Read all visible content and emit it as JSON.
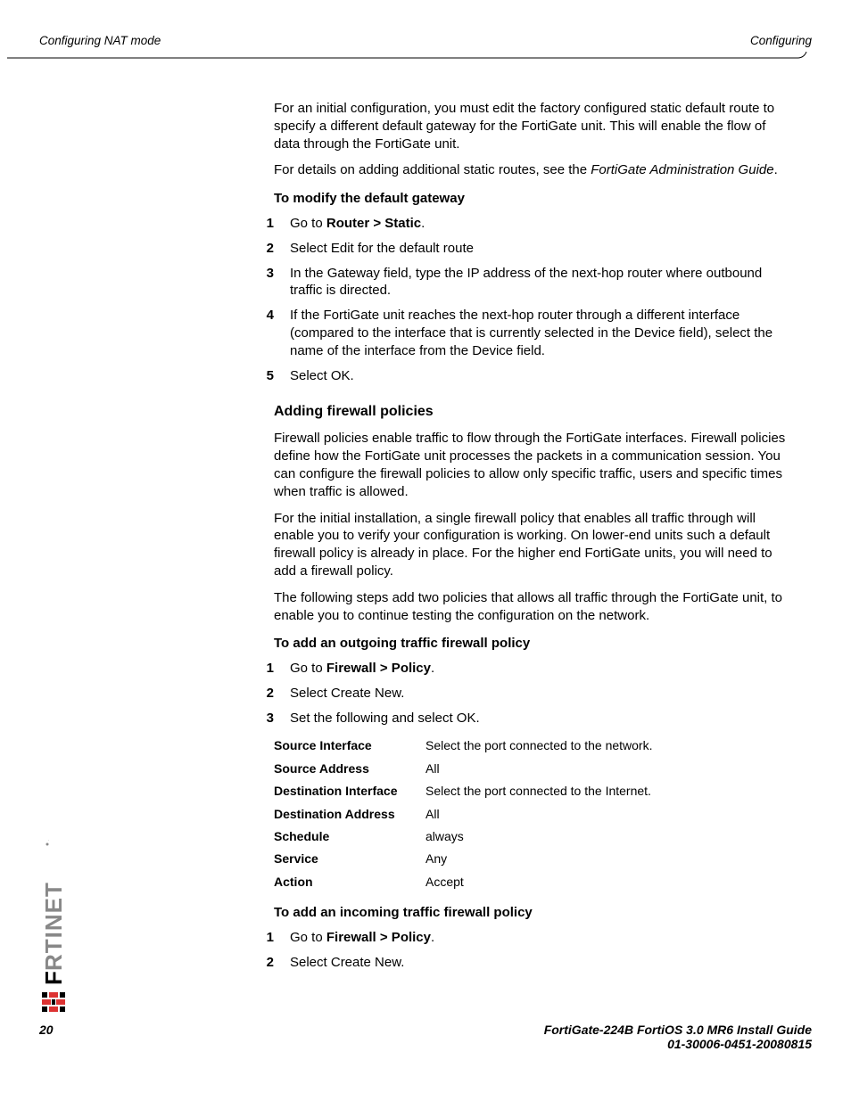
{
  "header": {
    "left": "Configuring NAT mode",
    "right": "Configuring"
  },
  "intro": {
    "p1": "For an initial configuration, you must edit the factory configured static default route to specify a different default gateway for the FortiGate unit. This will enable the flow of data through the FortiGate unit.",
    "p2_a": "For details on adding additional static routes, see the ",
    "p2_em": "FortiGate Administration Guide",
    "p2_b": "."
  },
  "modify_gw": {
    "heading": "To modify the default gateway",
    "steps": [
      {
        "n": "1",
        "pre": "Go to ",
        "bold": "Router > Static",
        "post": "."
      },
      {
        "n": "2",
        "text": "Select Edit for the default route"
      },
      {
        "n": "3",
        "text": "In the Gateway field, type the IP address of the next-hop router where outbound traffic is directed."
      },
      {
        "n": "4",
        "text": "If the FortiGate unit reaches the next-hop router through a different interface (compared to the interface that is currently selected in the Device field), select the name of the interface from the Device field."
      },
      {
        "n": "5",
        "text": "Select OK."
      }
    ]
  },
  "firewall": {
    "heading": "Adding firewall policies",
    "p1": "Firewall policies enable traffic to flow through the FortiGate interfaces. Firewall policies define how the FortiGate unit processes the packets in a communication session. You can configure the firewall policies to allow only specific traffic, users and specific times when traffic is allowed.",
    "p2": "For the initial installation, a single firewall policy that enables all traffic through will enable you to verify your configuration is working. On lower-end units such a default firewall policy is already in place. For the higher end FortiGate units, you will need to add a firewall policy.",
    "p3": "The following steps add two policies that allows all traffic through the FortiGate unit, to enable you to continue testing the configuration on the network."
  },
  "outgoing": {
    "heading": "To add an outgoing traffic firewall policy",
    "steps": [
      {
        "n": "1",
        "pre": "Go to ",
        "bold": "Firewall > Policy",
        "post": "."
      },
      {
        "n": "2",
        "text": "Select Create New."
      },
      {
        "n": "3",
        "text": "Set the following and select OK."
      }
    ],
    "settings": [
      {
        "k": "Source Interface",
        "v": "Select the port connected to the network."
      },
      {
        "k": "Source Address",
        "v": "All"
      },
      {
        "k": "Destination Interface",
        "v": "Select the port connected to the Internet."
      },
      {
        "k": "Destination Address",
        "v": "All"
      },
      {
        "k": "Schedule",
        "v": "always"
      },
      {
        "k": "Service",
        "v": "Any"
      },
      {
        "k": "Action",
        "v": "Accept"
      }
    ]
  },
  "incoming": {
    "heading": "To add an incoming traffic firewall policy",
    "steps": [
      {
        "n": "1",
        "pre": "Go to ",
        "bold": "Firewall > Policy",
        "post": "."
      },
      {
        "n": "2",
        "text": "Select Create New."
      }
    ]
  },
  "footer": {
    "page": "20",
    "line1": "FortiGate-224B FortiOS 3.0 MR6 Install Guide",
    "line2": "01-30006-0451-20080815"
  }
}
